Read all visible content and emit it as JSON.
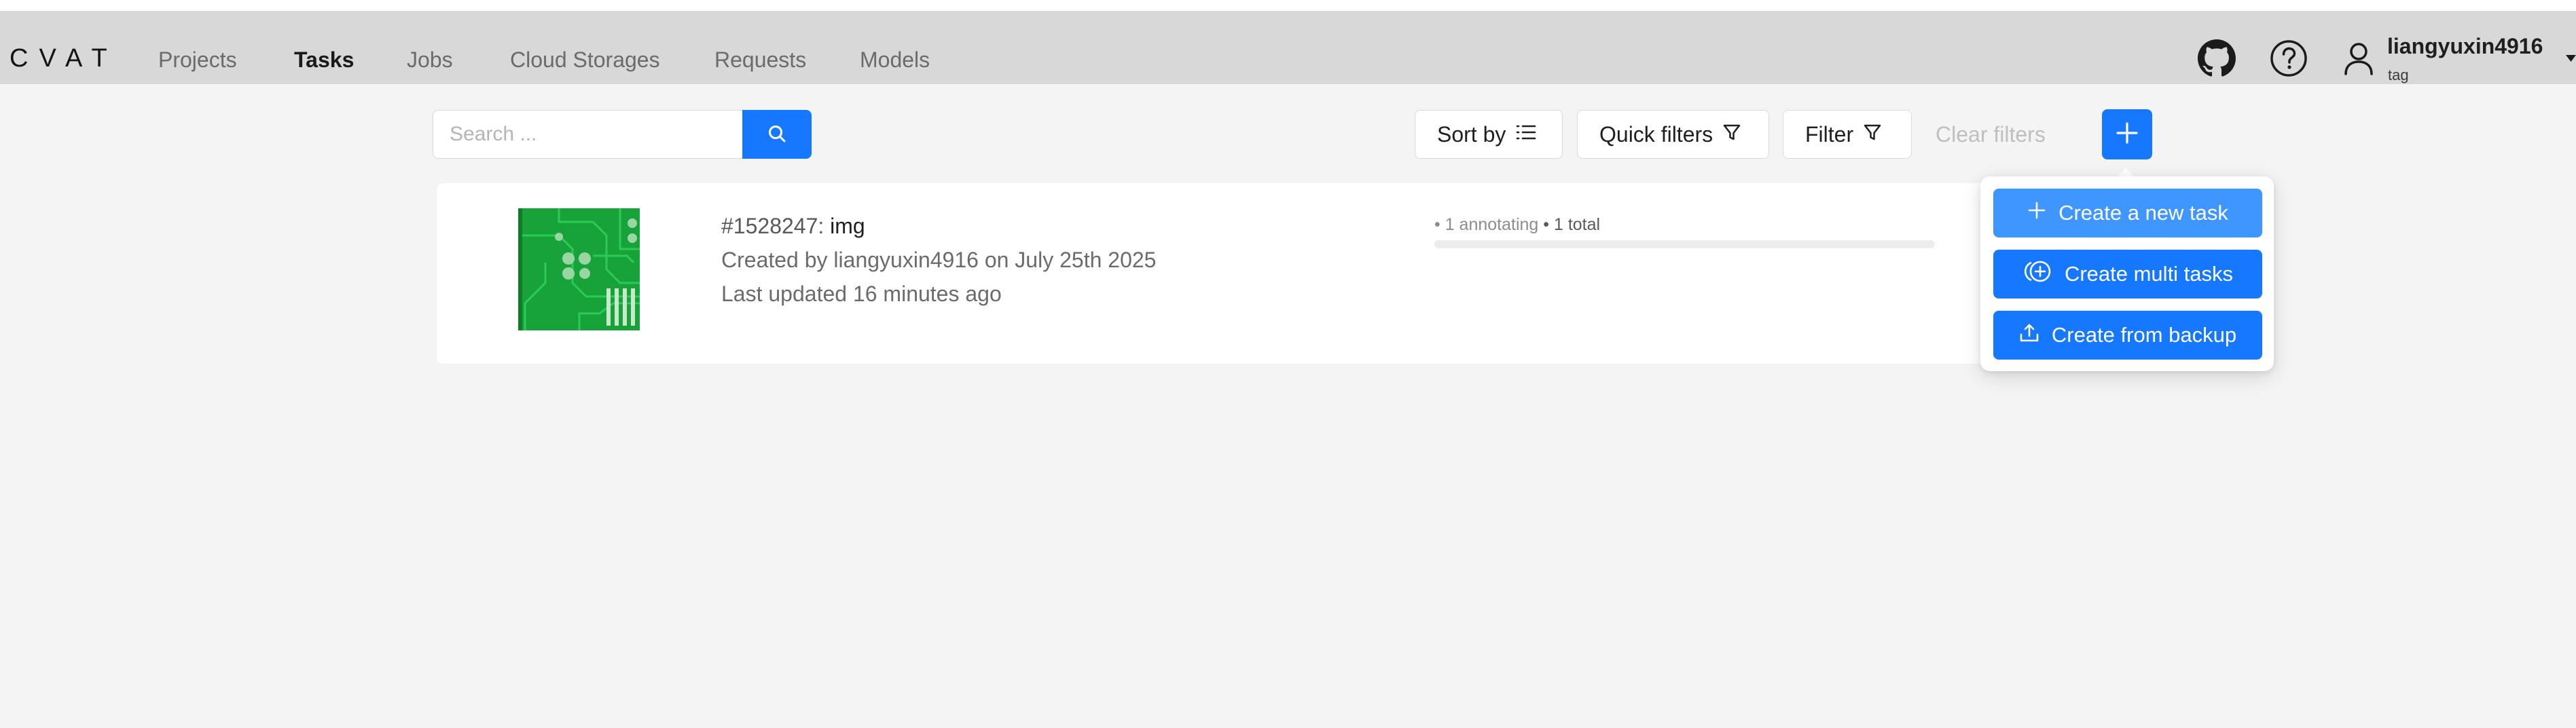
{
  "header": {
    "logo": "CVAT",
    "nav": [
      "Projects",
      "Tasks",
      "Jobs",
      "Cloud Storages",
      "Requests",
      "Models"
    ],
    "active_nav": "Tasks",
    "user": {
      "name": "liangyuxin4916",
      "org": "tag"
    },
    "icons": [
      "github-icon",
      "help-icon",
      "user-icon",
      "caret-down-icon"
    ]
  },
  "toolbar": {
    "search_placeholder": "Search ...",
    "sort_label": "Sort by",
    "quick_filters_label": "Quick filters",
    "filter_label": "Filter",
    "clear_filters_label": "Clear filters"
  },
  "tasks": [
    {
      "id": "#1528247:",
      "name": "img",
      "created": "Created by liangyuxin4916 on July 25th 2025",
      "updated": "Last updated 16 minutes ago",
      "progress_annotating": "• 1 annotating",
      "progress_total": "• 1 total",
      "progress_fraction": 0
    }
  ],
  "create_menu": {
    "items": [
      {
        "label": "Create a new task",
        "icon": "plus-icon"
      },
      {
        "label": "Create multi tasks",
        "icon": "plus-circle-icon"
      },
      {
        "label": "Create from backup",
        "icon": "upload-icon"
      }
    ]
  },
  "colors": {
    "primary": "#1677ff",
    "primary_hover": "#4096ff",
    "header_bg": "#d8d8d8",
    "page_bg": "#f4f4f4",
    "thumbnail_green": "#17a33a"
  }
}
